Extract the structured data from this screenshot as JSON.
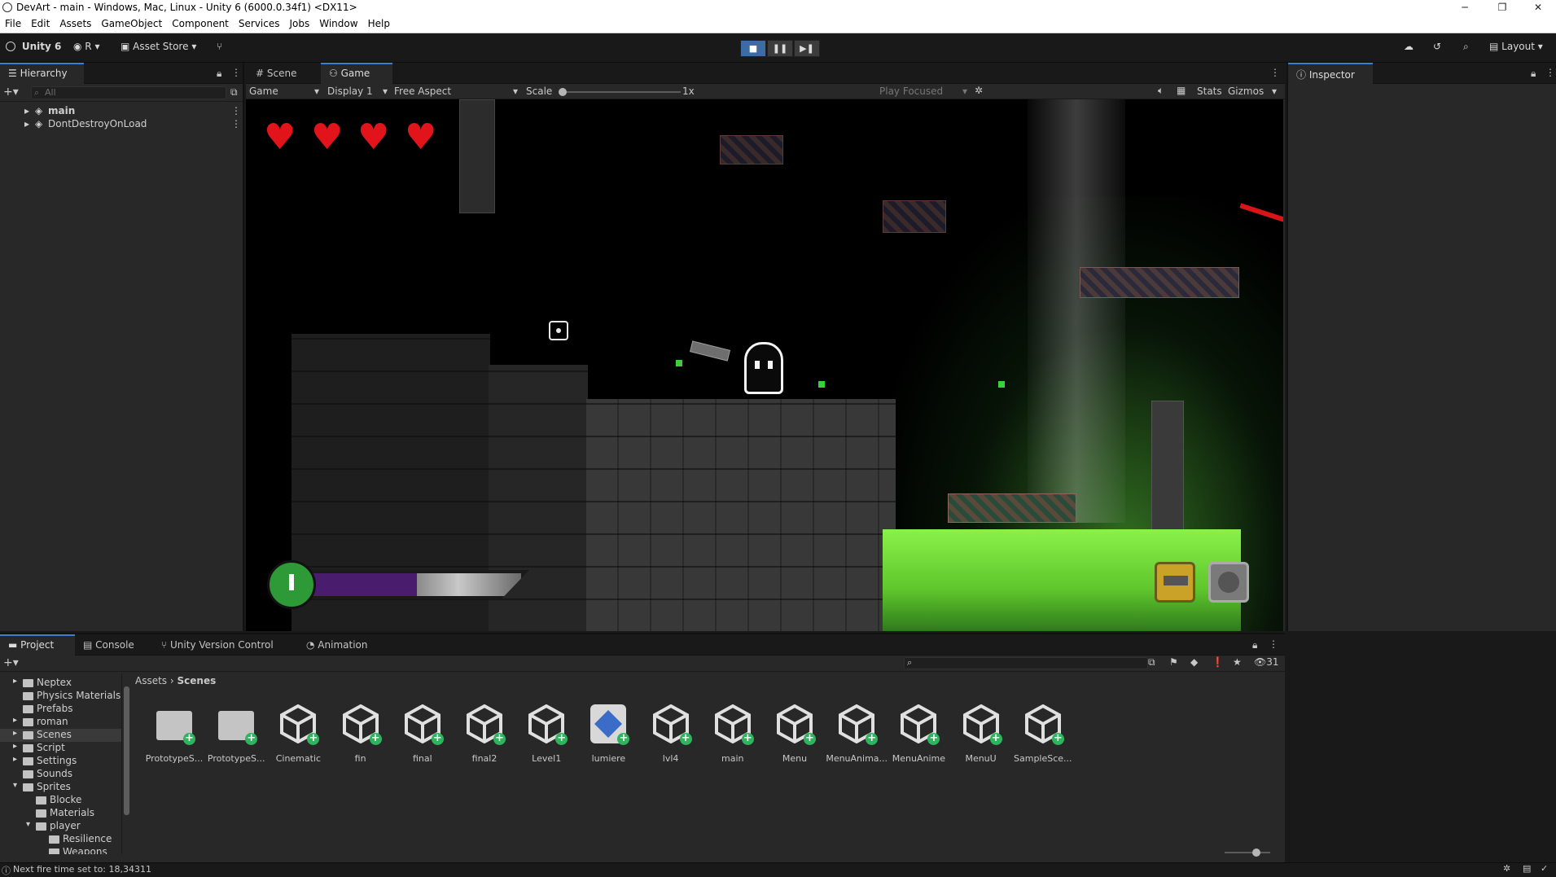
{
  "window": {
    "title": "DevArt - main - Windows, Mac, Linux - Unity 6 (6000.0.34f1) <DX11>",
    "controls": [
      "─",
      "❐",
      "✕"
    ]
  },
  "menu": [
    "File",
    "Edit",
    "Assets",
    "GameObject",
    "Component",
    "Services",
    "Jobs",
    "Window",
    "Help"
  ],
  "toolbar": {
    "unity_label": "Unity 6",
    "account_label": "R",
    "asset_store_label": "Asset Store",
    "layout_label": "Layout"
  },
  "hierarchy": {
    "tab": "Hierarchy",
    "search_placeholder": "All",
    "items": [
      "main",
      "DontDestroyOnLoad"
    ]
  },
  "scene_tabs": {
    "scene": "Scene",
    "game": "Game"
  },
  "game_toolbar": {
    "mode": "Game",
    "display": "Display 1",
    "aspect": "Free Aspect",
    "scale_label": "Scale",
    "scale_value": "1x",
    "play_focused": "Play Focused",
    "stats": "Stats",
    "gizmos": "Gizmos"
  },
  "game_hud": {
    "hearts": 4,
    "energy_fill": 0.52
  },
  "inspector": {
    "tab": "Inspector"
  },
  "project": {
    "tabs": [
      "Project",
      "Console",
      "Unity Version Control",
      "Animation"
    ],
    "count": "31",
    "breadcrumb": [
      "Assets",
      "Scenes"
    ],
    "tree": [
      {
        "label": "Neptex",
        "depth": 1,
        "expanded": false
      },
      {
        "label": "Physics Materials",
        "depth": 1,
        "expanded": null
      },
      {
        "label": "Prefabs",
        "depth": 1,
        "expanded": null
      },
      {
        "label": "roman",
        "depth": 1,
        "expanded": false
      },
      {
        "label": "Scenes",
        "depth": 1,
        "expanded": false,
        "selected": true
      },
      {
        "label": "Script",
        "depth": 1,
        "expanded": false
      },
      {
        "label": "Settings",
        "depth": 1,
        "expanded": false
      },
      {
        "label": "Sounds",
        "depth": 1,
        "expanded": null
      },
      {
        "label": "Sprites",
        "depth": 1,
        "expanded": true
      },
      {
        "label": "Blocke",
        "depth": 2,
        "expanded": null
      },
      {
        "label": "Materials",
        "depth": 2,
        "expanded": null
      },
      {
        "label": "player",
        "depth": 2,
        "expanded": true
      },
      {
        "label": "Resilience",
        "depth": 3,
        "expanded": null
      },
      {
        "label": "Weapons",
        "depth": 3,
        "expanded": null
      }
    ],
    "assets": [
      {
        "label": "PrototypeS...",
        "kind": "folder"
      },
      {
        "label": "PrototypeS...",
        "kind": "folder"
      },
      {
        "label": "Cinematic",
        "kind": "scene"
      },
      {
        "label": "fin",
        "kind": "scene"
      },
      {
        "label": "final",
        "kind": "scene"
      },
      {
        "label": "final2",
        "kind": "scene"
      },
      {
        "label": "Level1",
        "kind": "scene"
      },
      {
        "label": "lumiere",
        "kind": "lighting"
      },
      {
        "label": "lvl4",
        "kind": "scene"
      },
      {
        "label": "main",
        "kind": "scene"
      },
      {
        "label": "Menu",
        "kind": "scene"
      },
      {
        "label": "MenuAnima...",
        "kind": "scene"
      },
      {
        "label": "MenuAnime",
        "kind": "scene"
      },
      {
        "label": "MenuU",
        "kind": "scene"
      },
      {
        "label": "SampleSce...",
        "kind": "scene"
      }
    ]
  },
  "status": {
    "message": "Next fire time set to: 18,34311"
  },
  "colors": {
    "accent": "#3c7fd1",
    "heart": "#e0141a",
    "acid": "#7be53b",
    "add_badge": "#2fb35c"
  }
}
